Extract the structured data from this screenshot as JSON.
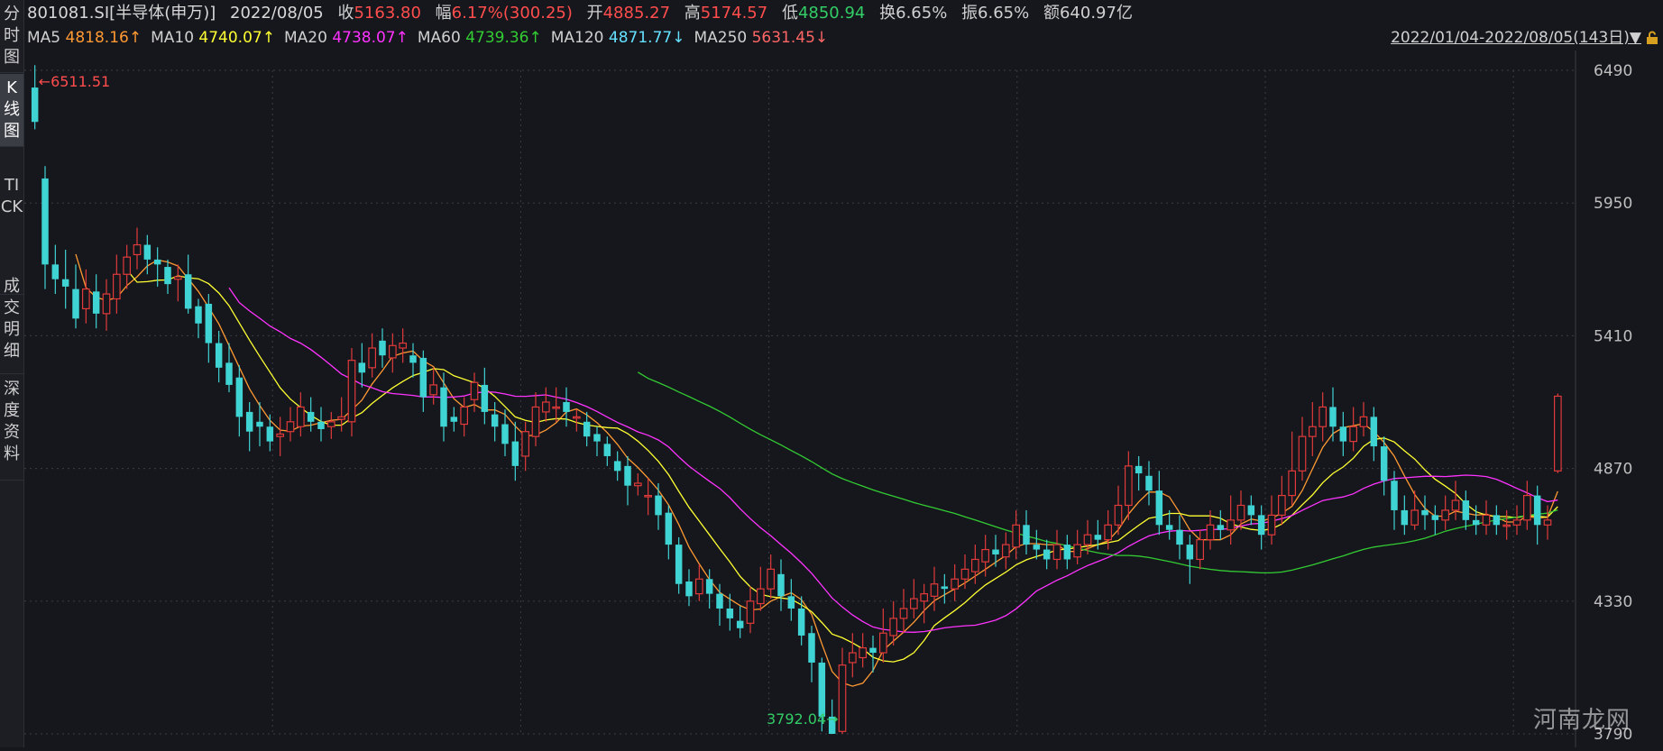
{
  "sidebar": {
    "tabs": [
      {
        "label": "分时图",
        "active": false
      },
      {
        "label": "K线图",
        "active": true
      },
      {
        "label": "TICK",
        "active": false
      },
      {
        "label": "成交明细",
        "active": false
      },
      {
        "label": "深度资料",
        "active": false
      }
    ]
  },
  "info": {
    "code": "801081.SI[半导体(申万)]",
    "date": "2022/08/05",
    "close_label": "收",
    "close": "5163.80",
    "change_label": "幅",
    "change": "6.17%(300.25)",
    "open_label": "开",
    "open": "4885.27",
    "high_label": "高",
    "high": "5174.57",
    "low_label": "低",
    "low": "4850.94",
    "turnover_label": "换",
    "turnover": "6.65%",
    "amplitude_label": "振",
    "amplitude": "6.65%",
    "amount_label": "额",
    "amount": "640.97亿"
  },
  "ma_bar": [
    {
      "label": "MA5",
      "value": "4818.16↑",
      "color": "#ff9933"
    },
    {
      "label": "MA10",
      "value": "4740.07↑",
      "color": "#ffff33"
    },
    {
      "label": "MA20",
      "value": "4738.07↑",
      "color": "#ff33ff"
    },
    {
      "label": "MA60",
      "value": "4739.36↑",
      "color": "#33cc33"
    },
    {
      "label": "MA120",
      "value": "4871.77↓",
      "color": "#66e0ff"
    },
    {
      "label": "MA250",
      "value": "5631.45↓",
      "color": "#ff6666"
    }
  ],
  "date_range": "2022/01/04-2022/08/05(143日)▼",
  "watermark": "河南龙网",
  "colors": {
    "up": "#e03a3a",
    "down": "#3fd3d3",
    "bg": "#15171c",
    "grid": "#3a3d44"
  },
  "chart_data": {
    "type": "candlestick",
    "y_ticks": [
      6490,
      5950,
      5410,
      4870,
      4330,
      3790
    ],
    "ylim": [
      3790,
      6490
    ],
    "max_label": "6511.51",
    "min_label": "3792.04",
    "candles": [
      [
        6420,
        6280,
        6511,
        6250
      ],
      [
        6050,
        5700,
        6100,
        5600
      ],
      [
        5700,
        5640,
        5780,
        5580
      ],
      [
        5640,
        5610,
        5760,
        5520
      ],
      [
        5600,
        5480,
        5700,
        5440
      ],
      [
        5520,
        5600,
        5680,
        5460
      ],
      [
        5590,
        5500,
        5660,
        5440
      ],
      [
        5500,
        5580,
        5640,
        5430
      ],
      [
        5560,
        5660,
        5740,
        5500
      ],
      [
        5660,
        5730,
        5780,
        5600
      ],
      [
        5740,
        5780,
        5850,
        5680
      ],
      [
        5780,
        5720,
        5820,
        5660
      ],
      [
        5720,
        5700,
        5770,
        5610
      ],
      [
        5690,
        5620,
        5720,
        5580
      ],
      [
        5640,
        5650,
        5700,
        5550
      ],
      [
        5660,
        5520,
        5740,
        5500
      ],
      [
        5530,
        5460,
        5560,
        5400
      ],
      [
        5540,
        5380,
        5580,
        5300
      ],
      [
        5380,
        5280,
        5430,
        5220
      ],
      [
        5300,
        5210,
        5380,
        5180
      ],
      [
        5240,
        5080,
        5290,
        5000
      ],
      [
        5100,
        5020,
        5140,
        4940
      ],
      [
        5060,
        5040,
        5140,
        4960
      ],
      [
        5040,
        4980,
        5090,
        4940
      ],
      [
        5000,
        5010,
        5080,
        4920
      ],
      [
        5020,
        5060,
        5120,
        4980
      ],
      [
        5040,
        5120,
        5180,
        5000
      ],
      [
        5100,
        5060,
        5160,
        5020
      ],
      [
        5060,
        5030,
        5120,
        4980
      ],
      [
        5040,
        5060,
        5100,
        4990
      ],
      [
        5070,
        5080,
        5160,
        5020
      ],
      [
        5060,
        5310,
        5360,
        5000
      ],
      [
        5300,
        5260,
        5380,
        5200
      ],
      [
        5280,
        5360,
        5420,
        5240
      ],
      [
        5390,
        5330,
        5440,
        5280
      ],
      [
        5320,
        5370,
        5420,
        5260
      ],
      [
        5360,
        5380,
        5440,
        5300
      ],
      [
        5330,
        5300,
        5380,
        5240
      ],
      [
        5320,
        5160,
        5350,
        5100
      ],
      [
        5170,
        5210,
        5280,
        5130
      ],
      [
        5200,
        5040,
        5260,
        4980
      ],
      [
        5080,
        5060,
        5120,
        5020
      ],
      [
        5050,
        5120,
        5160,
        5000
      ],
      [
        5150,
        5220,
        5260,
        5100
      ],
      [
        5210,
        5100,
        5280,
        5050
      ],
      [
        5090,
        5040,
        5140,
        4980
      ],
      [
        5050,
        4970,
        5110,
        4920
      ],
      [
        4980,
        4880,
        5060,
        4820
      ],
      [
        4920,
        5020,
        5060,
        4860
      ],
      [
        5000,
        5120,
        5180,
        4960
      ],
      [
        5100,
        5140,
        5200,
        5060
      ],
      [
        5120,
        5120,
        5200,
        5060
      ],
      [
        5140,
        5100,
        5200,
        5040
      ],
      [
        5080,
        5080,
        5110,
        5020
      ],
      [
        5060,
        5000,
        5100,
        4960
      ],
      [
        5010,
        4980,
        5040,
        4920
      ],
      [
        4970,
        4920,
        5000,
        4880
      ],
      [
        4900,
        4860,
        4940,
        4820
      ],
      [
        4880,
        4800,
        4920,
        4720
      ],
      [
        4800,
        4810,
        4850,
        4760
      ],
      [
        4760,
        4760,
        4830,
        4680
      ],
      [
        4760,
        4680,
        4810,
        4620
      ],
      [
        4690,
        4560,
        4720,
        4500
      ],
      [
        4560,
        4400,
        4590,
        4360
      ],
      [
        4410,
        4350,
        4460,
        4310
      ],
      [
        4360,
        4420,
        4480,
        4330
      ],
      [
        4420,
        4360,
        4460,
        4300
      ],
      [
        4360,
        4300,
        4400,
        4230
      ],
      [
        4300,
        4260,
        4360,
        4210
      ],
      [
        4250,
        4220,
        4310,
        4180
      ],
      [
        4240,
        4330,
        4390,
        4200
      ],
      [
        4320,
        4380,
        4470,
        4290
      ],
      [
        4380,
        4460,
        4520,
        4340
      ],
      [
        4440,
        4350,
        4500,
        4290
      ],
      [
        4350,
        4300,
        4420,
        4250
      ],
      [
        4300,
        4190,
        4350,
        4150
      ],
      [
        4200,
        4080,
        4230,
        4000
      ],
      [
        4080,
        3860,
        4100,
        3800
      ],
      [
        3860,
        3790,
        3930,
        3792
      ],
      [
        3800,
        4070,
        4140,
        3790
      ],
      [
        4080,
        4120,
        4200,
        4020
      ],
      [
        4100,
        4140,
        4200,
        4060
      ],
      [
        4140,
        4120,
        4190,
        4040
      ],
      [
        4120,
        4200,
        4300,
        4080
      ],
      [
        4190,
        4260,
        4330,
        4150
      ],
      [
        4260,
        4300,
        4380,
        4200
      ],
      [
        4300,
        4340,
        4420,
        4260
      ],
      [
        4330,
        4360,
        4400,
        4240
      ],
      [
        4350,
        4400,
        4470,
        4290
      ],
      [
        4390,
        4380,
        4440,
        4320
      ],
      [
        4380,
        4420,
        4480,
        4330
      ],
      [
        4420,
        4460,
        4520,
        4380
      ],
      [
        4450,
        4500,
        4560,
        4400
      ],
      [
        4490,
        4540,
        4600,
        4430
      ],
      [
        4540,
        4520,
        4600,
        4470
      ],
      [
        4510,
        4560,
        4610,
        4460
      ],
      [
        4550,
        4640,
        4700,
        4500
      ],
      [
        4640,
        4560,
        4700,
        4520
      ],
      [
        4560,
        4540,
        4620,
        4500
      ],
      [
        4540,
        4500,
        4580,
        4460
      ],
      [
        4500,
        4560,
        4620,
        4460
      ],
      [
        4560,
        4500,
        4600,
        4460
      ],
      [
        4510,
        4560,
        4620,
        4480
      ],
      [
        4560,
        4600,
        4660,
        4520
      ],
      [
        4600,
        4580,
        4660,
        4540
      ],
      [
        4580,
        4640,
        4700,
        4540
      ],
      [
        4640,
        4720,
        4800,
        4600
      ],
      [
        4720,
        4880,
        4940,
        4660
      ],
      [
        4880,
        4850,
        4920,
        4780
      ],
      [
        4840,
        4780,
        4900,
        4720
      ],
      [
        4780,
        4640,
        4860,
        4600
      ],
      [
        4640,
        4620,
        4700,
        4580
      ],
      [
        4620,
        4560,
        4680,
        4500
      ],
      [
        4560,
        4500,
        4600,
        4400
      ],
      [
        4500,
        4580,
        4620,
        4460
      ],
      [
        4580,
        4640,
        4700,
        4540
      ],
      [
        4640,
        4620,
        4700,
        4580
      ],
      [
        4620,
        4660,
        4760,
        4560
      ],
      [
        4660,
        4720,
        4780,
        4620
      ],
      [
        4720,
        4680,
        4760,
        4640
      ],
      [
        4680,
        4600,
        4720,
        4540
      ],
      [
        4600,
        4680,
        4760,
        4560
      ],
      [
        4680,
        4760,
        4840,
        4640
      ],
      [
        4760,
        4860,
        5020,
        4720
      ],
      [
        4860,
        5000,
        5080,
        4820
      ],
      [
        5000,
        5040,
        5140,
        4920
      ],
      [
        5040,
        5120,
        5180,
        4980
      ],
      [
        5120,
        5040,
        5200,
        4980
      ],
      [
        5040,
        4980,
        5100,
        4920
      ],
      [
        4980,
        5040,
        5120,
        4940
      ],
      [
        5040,
        5080,
        5140,
        5000
      ],
      [
        5080,
        4960,
        5120,
        4900
      ],
      [
        4960,
        4820,
        5000,
        4760
      ],
      [
        4820,
        4700,
        4860,
        4620
      ],
      [
        4700,
        4640,
        4760,
        4600
      ],
      [
        4640,
        4700,
        4780,
        4620
      ],
      [
        4700,
        4680,
        4760,
        4620
      ],
      [
        4680,
        4660,
        4720,
        4600
      ],
      [
        4660,
        4700,
        4760,
        4620
      ],
      [
        4700,
        4740,
        4820,
        4660
      ],
      [
        4740,
        4660,
        4780,
        4620
      ],
      [
        4660,
        4640,
        4720,
        4600
      ],
      [
        4640,
        4680,
        4740,
        4600
      ],
      [
        4680,
        4640,
        4720,
        4600
      ],
      [
        4640,
        4640,
        4700,
        4580
      ],
      [
        4640,
        4660,
        4720,
        4600
      ],
      [
        4660,
        4760,
        4820,
        4620
      ],
      [
        4760,
        4640,
        4800,
        4560
      ],
      [
        4640,
        4660,
        4720,
        4580
      ],
      [
        4860,
        5164,
        5175,
        4851
      ]
    ]
  }
}
